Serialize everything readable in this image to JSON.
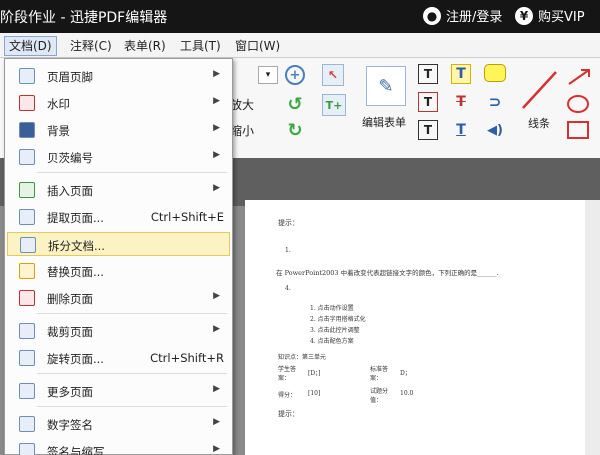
{
  "titlebar": {
    "title": "阶段作业 - 迅捷PDF编辑器",
    "login": "注册/登录",
    "vip": "购买VIP",
    "user_icon": "user-icon",
    "yen_icon": "yen-icon"
  },
  "menubar": {
    "items": [
      "文档(D)",
      "注释(C)",
      "表单(R)",
      "工具(T)",
      "窗口(W)"
    ]
  },
  "toolbar": {
    "zoom_in": "放大",
    "zoom_out": "缩小",
    "edit_form": "编辑表单",
    "lines": "线条"
  },
  "dropdown": {
    "items": [
      {
        "label": "页眉页脚",
        "shortcut": "",
        "submenu": true
      },
      {
        "label": "水印",
        "shortcut": "",
        "submenu": true
      },
      {
        "label": "背景",
        "shortcut": "",
        "submenu": true
      },
      {
        "label": "贝茨编号",
        "shortcut": "",
        "submenu": true
      },
      {
        "label": "插入页面",
        "shortcut": "",
        "submenu": true
      },
      {
        "label": "提取页面...",
        "shortcut": "Ctrl+Shift+E",
        "submenu": false
      },
      {
        "label": "拆分文档...",
        "shortcut": "",
        "submenu": false,
        "highlighted": true
      },
      {
        "label": "替换页面...",
        "shortcut": "",
        "submenu": false
      },
      {
        "label": "删除页面",
        "shortcut": "",
        "submenu": true
      },
      {
        "label": "裁剪页面",
        "shortcut": "",
        "submenu": true
      },
      {
        "label": "旋转页面...",
        "shortcut": "Ctrl+Shift+R",
        "submenu": false
      },
      {
        "label": "更多页面",
        "shortcut": "",
        "submenu": true
      },
      {
        "label": "数字签名",
        "shortcut": "",
        "submenu": true
      },
      {
        "label": "签名与缩写",
        "shortcut": "",
        "submenu": true
      }
    ]
  },
  "document": {
    "hint1": "提示：",
    "q1": "1.",
    "q1_text": "在 PowerPoint2003 中着改变代表超链接文字的颜色，下列正确的是______.",
    "q4": "4.",
    "options": [
      "1. 点击动作设置",
      "2. 点击字用搭格式化",
      "3. 点击此控片调整",
      "4. 点击配色方案"
    ],
    "knowledge": "知识点：第三单元",
    "student_ans_label": "学生答案：",
    "student_ans": "[D；]",
    "std_ans_label": "标准答案：",
    "std_ans": "D；",
    "score_label": "得分：",
    "score": "[10]",
    "test_score_label": "试题分值：",
    "test_score": "10.0",
    "hint2": "提示："
  }
}
